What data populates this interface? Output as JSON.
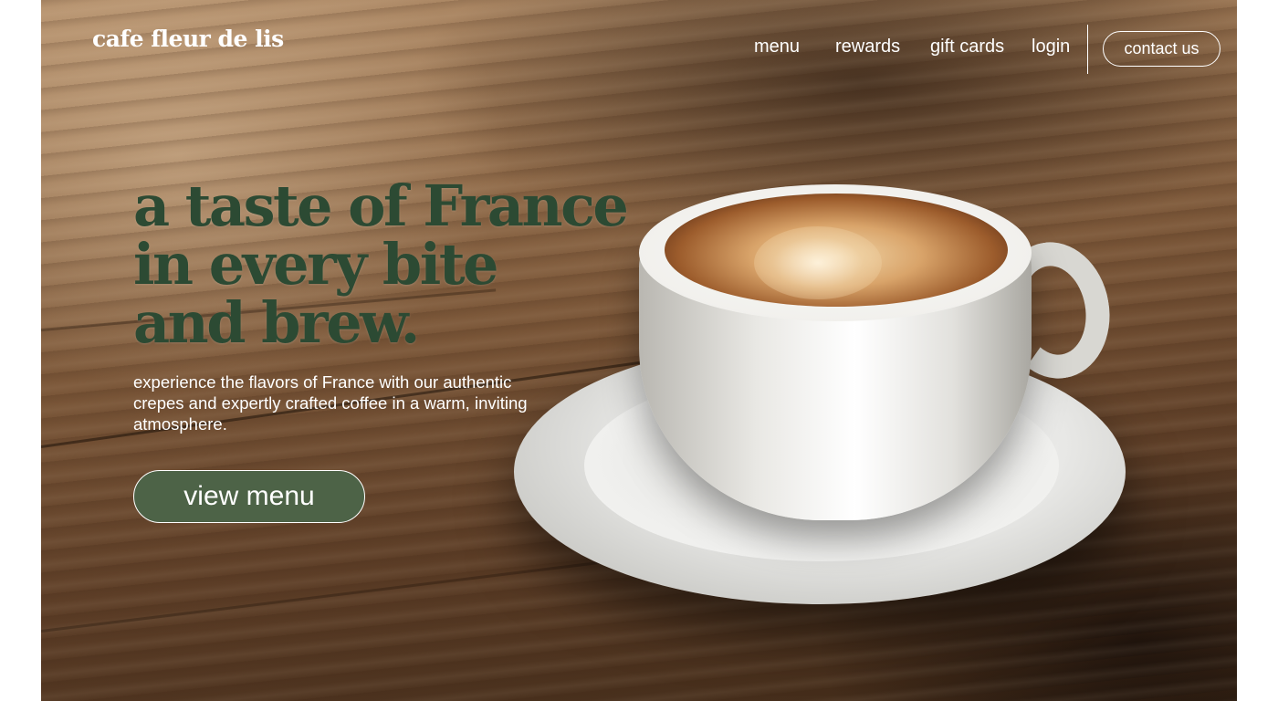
{
  "brand": {
    "name": "cafe fleur de lis"
  },
  "nav": {
    "items": [
      {
        "label": "menu"
      },
      {
        "label": "rewards"
      },
      {
        "label": "gift cards"
      },
      {
        "label": "login"
      }
    ],
    "contact_label": "contact us"
  },
  "hero": {
    "headline_lines": [
      "a taste of France",
      "in every bite",
      "and brew."
    ],
    "subtext": "experience the flavors of France with our authentic crepes and expertly crafted coffee in a warm, inviting atmosphere.",
    "cta_label": "view menu"
  },
  "colors": {
    "headline": "#2c4a33",
    "cta_background": "#4d6347",
    "nav_text": "#ffffff"
  },
  "image": {
    "subject": "coffee-cup-on-saucer"
  }
}
